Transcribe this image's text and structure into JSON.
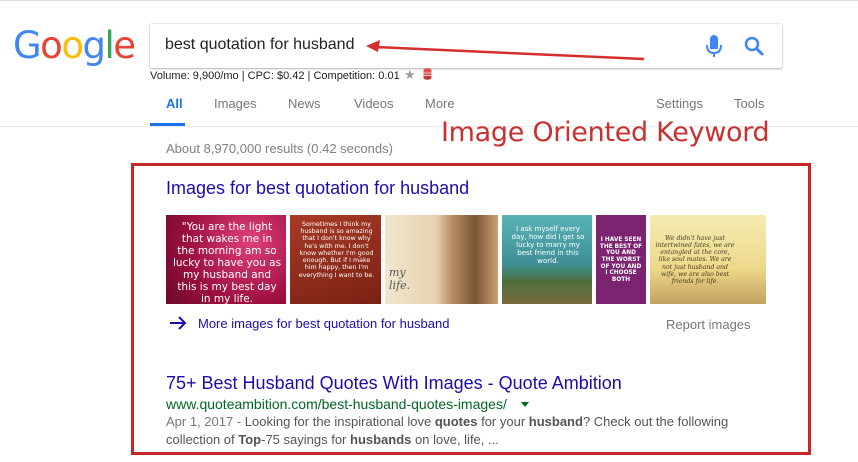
{
  "logo": {
    "letters": [
      "G",
      "o",
      "o",
      "g",
      "l",
      "e"
    ],
    "colors": [
      "#4285f4",
      "#ea4335",
      "#fbbc05",
      "#4285f4",
      "#34a853",
      "#ea4335"
    ]
  },
  "search": {
    "query": "best quotation for husband"
  },
  "metrics": "Volume: 9,900/mo | CPC: $0.42 | Competition: 0.01",
  "tabs": {
    "all": "All",
    "images": "Images",
    "news": "News",
    "videos": "Videos",
    "more": "More",
    "settings": "Settings",
    "tools": "Tools"
  },
  "result_stats": "About 8,970,000 results (0.42 seconds)",
  "annotation": {
    "label": "Image Oriented Keyword",
    "color": "#c62828"
  },
  "images_pack": {
    "heading": "Images for best quotation for husband",
    "thumbnails": [
      {
        "caption": "\"You are the light that wakes me in the morning am so lucky to have you as my husband and this is my best day in my life.",
        "bg": "#b0154a"
      },
      {
        "caption": "Sometimes I think my husband is so amazing that I don't know why he's with me. I don't know whether I'm good enough. But if I make him happy, then I'm everything I want to be.",
        "bg": "#8e2a1c"
      },
      {
        "caption": "my life.",
        "bg": "#e9dcc2"
      },
      {
        "caption": "I ask myself every day, how did I get so lucky to marry my best friend in this world.",
        "bg": "#3f8d91"
      },
      {
        "caption": "I HAVE SEEN THE BEST OF YOU AND THE WORST OF YOU AND I CHOOSE BOTH",
        "bg": "#7a1f6a"
      },
      {
        "caption": "We didn't have just intertwined fates, we are entangled at the core, like soul mates. We are not just husband and wife, we are also best friends for life.",
        "bg": "#efdf9a"
      }
    ],
    "more_link": "More images for best quotation for husband",
    "report": "Report images"
  },
  "result": {
    "title": "75+ Best Husband Quotes With Images - Quote Ambition",
    "url": "www.quoteambition.com/best-husband-quotes-images/",
    "snippet_date": "Apr 1, 2017 - ",
    "snippet_parts": [
      "Looking for the inspirational love ",
      "quotes",
      " for your ",
      "husband",
      "? Check out the following collection of ",
      "Top",
      "-75 sayings for ",
      "husbands",
      " on love, life, ..."
    ]
  },
  "icons": {
    "mic": "microphone-icon",
    "search": "search-icon",
    "star": "star-icon",
    "db": "database-icon",
    "arrow": "arrow-right-icon"
  }
}
